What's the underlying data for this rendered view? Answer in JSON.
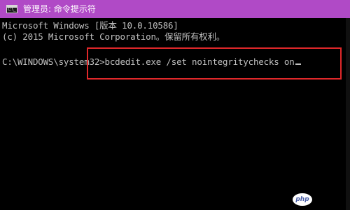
{
  "window": {
    "title": "管理员: 命令提示符",
    "icon": "cmd-icon",
    "icon_prompt": "C:\\_"
  },
  "console": {
    "lines": [
      "Microsoft Windows [版本 10.0.10586]",
      "(c) 2015 Microsoft Corporation。保留所有权利。",
      "",
      "C:\\WINDOWS\\system32>bcdedit.exe /set nointegritychecks on"
    ]
  },
  "colors": {
    "titlebar": "#b04ac6",
    "console_background": "#000000",
    "console_text": "#c0c0c0",
    "highlight_border": "#e0282a"
  },
  "watermark": {
    "text": "php"
  }
}
